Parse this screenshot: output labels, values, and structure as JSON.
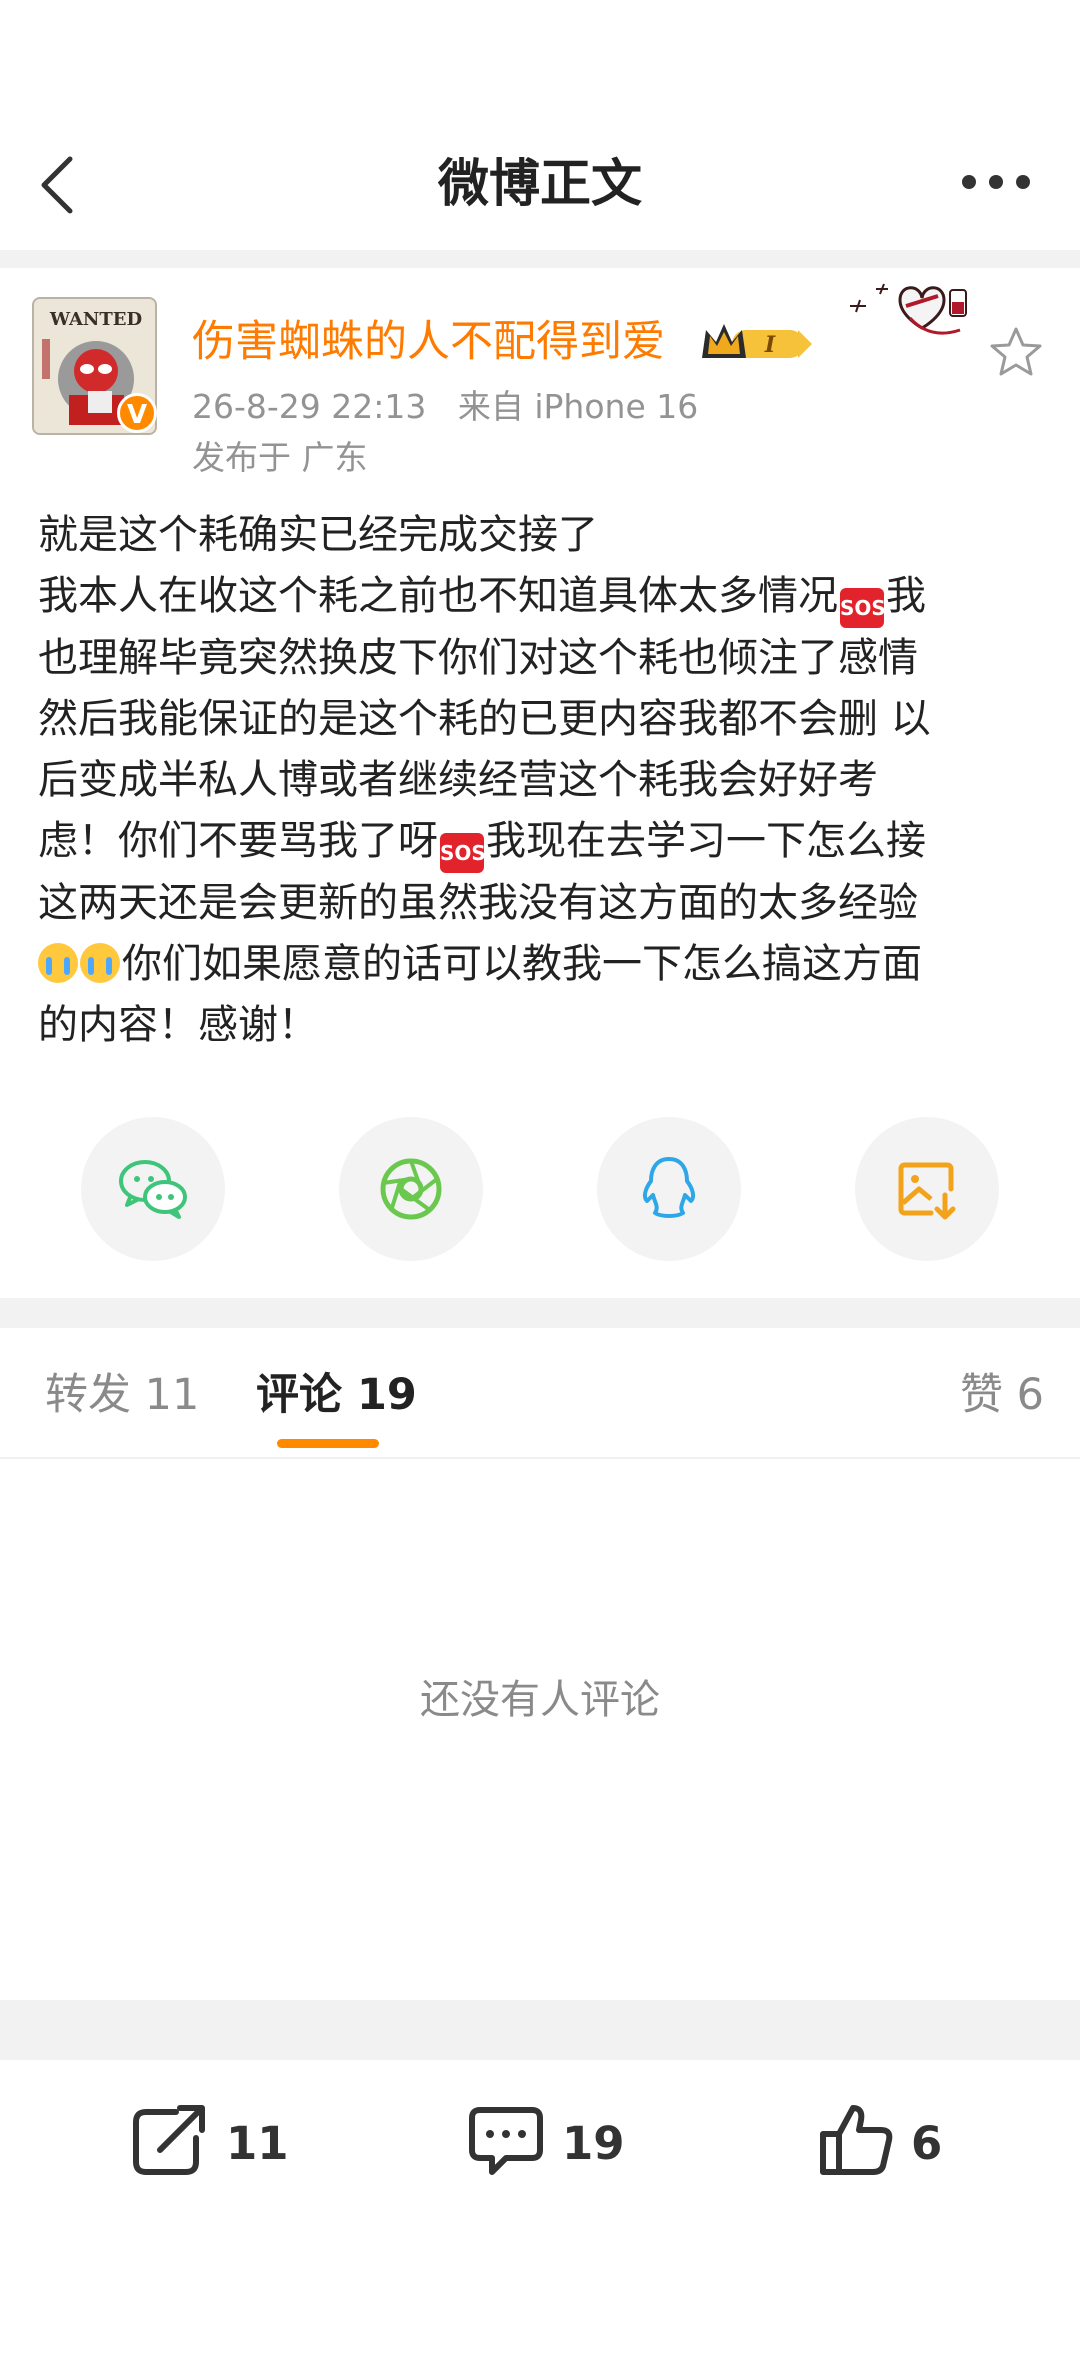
{
  "header": {
    "title": "微博正文"
  },
  "post": {
    "username": "伤害蜘蛛的人不配得到爱",
    "avatar_text": "WANTED",
    "verified_mark": "V",
    "crown_level": "I",
    "timestamp": "26-8-29 22:13",
    "source": "来自 iPhone 16",
    "location": "发布于 广东",
    "lines": [
      [
        "就是这个耗确实已经完成交接了"
      ],
      [
        "我本人在收这个耗之前也不知道具体太多情况",
        "{sos}",
        "我"
      ],
      [
        "也理解毕竟突然换皮下你们对这个耗也倾注了感情"
      ],
      [
        "然后我能保证的是这个耗的已更内容我都不会删 以"
      ],
      [
        "后变成半私人博或者继续经营这个耗我会好好考"
      ],
      [
        "虑！你们不要骂我了呀",
        "{sos}",
        "我现在去学习一下怎么接"
      ],
      [
        "这两天还是会更新的虽然我没有这方面的太多经验"
      ],
      [
        "{cry}",
        "{cry}",
        "你们如果愿意的话可以教我一下怎么搞这方面"
      ],
      [
        "的内容！感谢！"
      ]
    ],
    "sos_label": "SOS"
  },
  "share": [
    {
      "name": "wechat",
      "color": "#3fc57a"
    },
    {
      "name": "moments",
      "color": "#6bc84f"
    },
    {
      "name": "qq",
      "color": "#2ea7e8"
    },
    {
      "name": "save-image",
      "color": "#f3a21b"
    }
  ],
  "tabs": {
    "repost": "转发 11",
    "comment": "评论 19",
    "like": "赞 6"
  },
  "empty_text": "还没有人评论",
  "toolbar": {
    "repost_count": "11",
    "comment_count": "19",
    "like_count": "6"
  },
  "colors": {
    "accent": "#ff8a00",
    "username": "#ff7b00"
  }
}
